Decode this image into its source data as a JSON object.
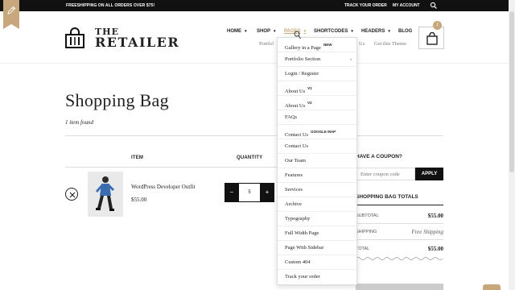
{
  "topbar": {
    "promo": "FREESHIPPING ON ALL ORDERS OVER $75!",
    "track_order": "TRACK YOUR ORDER",
    "my_account": "MY ACCOUNT",
    "search_icon": "search-icon"
  },
  "logo": {
    "line1": "THE",
    "line2": "RETAILER",
    "icon": "shopping-bag-icon"
  },
  "nav": {
    "home": "HOME",
    "shop": "SHOP",
    "pages": "PAGES",
    "shortcodes": "SHORTCODES",
    "headers": "HEADERS",
    "blog": "BLOG"
  },
  "subnav": {
    "portfolio": "Portfol",
    "about_us": "Us",
    "get_theme": "Get this Theme"
  },
  "cart": {
    "count": "1",
    "icon": "cart-bag-icon"
  },
  "page": {
    "title": "Shopping Bag",
    "item_count": "1 item found"
  },
  "table": {
    "col_item": "ITEM",
    "col_quantity": "QUANTITY"
  },
  "product": {
    "name": "WordPress Developer Outfit",
    "price": "$55.00",
    "quantity": "5",
    "minus": "−",
    "plus": "+"
  },
  "coupon": {
    "title": "HAVE A COUPON?",
    "placeholder": "Enter coupon code",
    "apply": "APPLY"
  },
  "totals": {
    "title": "SHOPPING BAG TOTALS",
    "subtotal_label": "SUBTOTAL",
    "subtotal_value": "$55.00",
    "shipping_label": "SHIPPING",
    "shipping_value": "Free Shipping",
    "total_label": "TOTAL",
    "total_value": "$55.00"
  },
  "dropdown": {
    "items": [
      {
        "label": "Gallery in a Page",
        "badge": "NEW"
      },
      {
        "label": "Portfolio Section",
        "badge": "",
        "arrow": "›"
      },
      {
        "label": "Login / Register",
        "badge": ""
      },
      {
        "label": "About Us",
        "badge": "V1"
      },
      {
        "label": "About Us",
        "badge": "V2"
      },
      {
        "label": "FAQs",
        "badge": ""
      },
      {
        "label": "Contact Us",
        "badge": "GOOGLE MAP"
      },
      {
        "label": "Contact Us",
        "badge": ""
      },
      {
        "label": "Our Team",
        "badge": ""
      },
      {
        "label": "Features",
        "badge": ""
      },
      {
        "label": "Services",
        "badge": ""
      },
      {
        "label": "Archive",
        "badge": ""
      },
      {
        "label": "Typography",
        "badge": ""
      },
      {
        "label": "Full Width Page",
        "badge": ""
      },
      {
        "label": "Page With Sidebar",
        "badge": ""
      },
      {
        "label": "Custom 404",
        "badge": ""
      },
      {
        "label": "Track your order",
        "badge": ""
      }
    ]
  },
  "colors": {
    "accent": "#c7a77b",
    "dark": "#111111"
  }
}
